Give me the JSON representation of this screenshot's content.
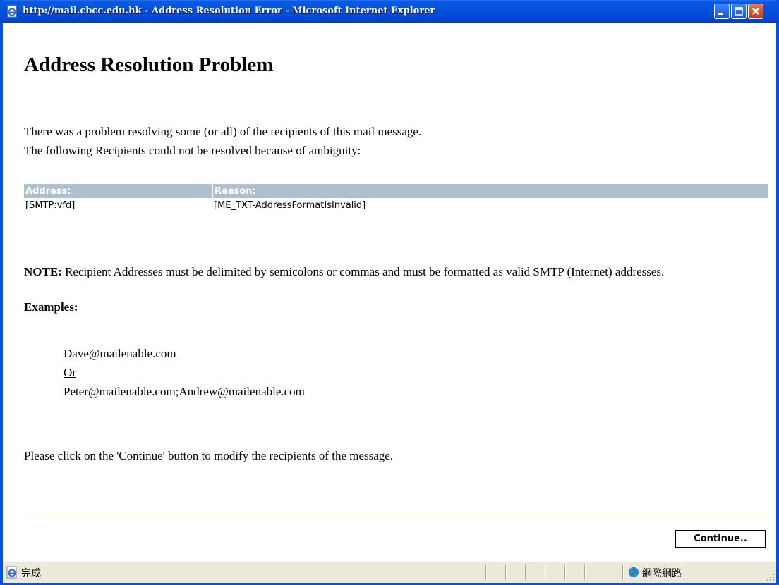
{
  "window": {
    "title": "http://mail.cbcc.edu.hk - Address Resolution Error - Microsoft Internet Explorer"
  },
  "page": {
    "heading": "Address Resolution Problem",
    "intro_line1": "There was a problem resolving some (or all) of the recipients of this mail message.",
    "intro_line2": "The following Recipients could not be resolved because of ambiguity:",
    "table": {
      "headers": [
        "Address:",
        "Reason:"
      ],
      "rows": [
        [
          "[SMTP:vfd]",
          "[ME_TXT-AddressFormatIsInvalid]"
        ]
      ]
    },
    "note_label": "NOTE:",
    "note_text": " Recipient Addresses must be delimited by semicolons or commas and must be formatted as valid SMTP (Internet) addresses.",
    "examples_label": "Examples:",
    "example1": "Dave@mailenable.com",
    "example_or": "Or",
    "example2": "Peter@mailenable.com;Andrew@mailenable.com",
    "instruction": "Please click on the 'Continue' button to modify the recipients of the message.",
    "continue_label": "Continue.."
  },
  "statusbar": {
    "status": "完成",
    "zone": "網際網路"
  },
  "icons": {
    "title_icon": "ie-page-icon",
    "status_icon": "ie-page-icon",
    "zone_icon": "globe-icon"
  },
  "colors": {
    "titlebar": "#0054e3",
    "table_header": "#aebfd0",
    "close_button": "#c4381a"
  }
}
